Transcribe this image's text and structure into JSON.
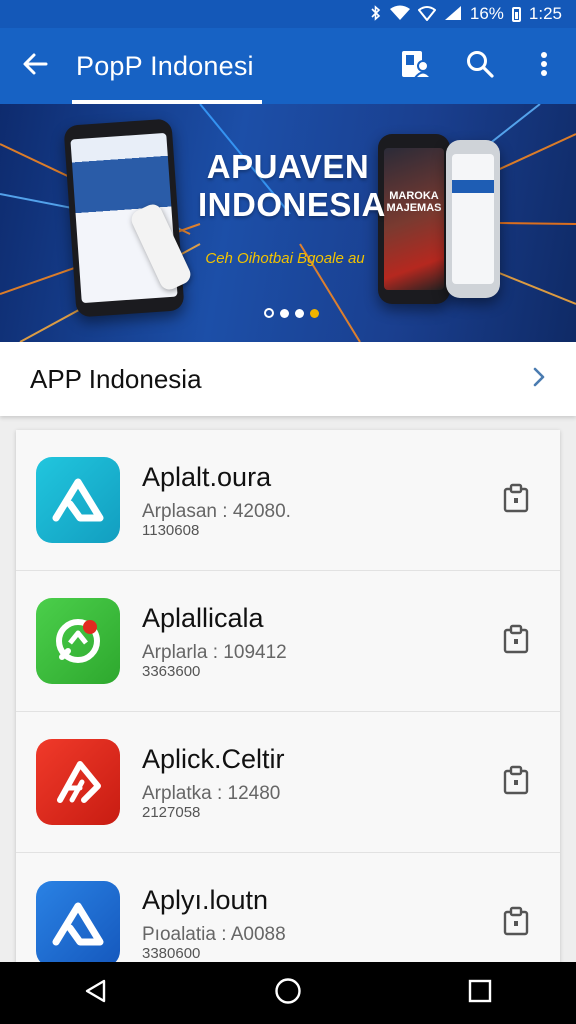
{
  "status_bar": {
    "battery_percent": "16%",
    "time": "1:25"
  },
  "app_bar": {
    "title": "PopP Indonesi"
  },
  "banner": {
    "title": "APUAVEN INDONESIA",
    "subtitle": "Ceh Oihotbai Bgoale au",
    "phone_caption": "MAROKA MAJEMAS",
    "slides": [
      {
        "style": "ring"
      },
      {
        "style": "plain"
      },
      {
        "style": "plain"
      },
      {
        "style": "active"
      }
    ]
  },
  "section": {
    "title": "APP Indonesia"
  },
  "apps": [
    {
      "name": "Aplalt.oura",
      "meta": "Arplasan : 42080.",
      "meta2": "1130608",
      "color": "#1cb7d3",
      "icon": "teal-arrow-icon"
    },
    {
      "name": "Aplallicala",
      "meta": "Arplarla : 109412",
      "meta2": "3363600",
      "color": "#3dbb3d",
      "icon": "green-chat-icon"
    },
    {
      "name": "Aplick.Celtir",
      "meta": "Arplatka : 12480",
      "meta2": "2127058",
      "color": "#e6281e",
      "icon": "red-arrow-icon"
    },
    {
      "name": "Aplyı.loutn",
      "meta": "Pıoalatia : A0088",
      "meta2": "3380600",
      "color": "#1f6fd1",
      "icon": "blue-arrow-icon"
    }
  ],
  "colors": {
    "app_bar": "#1762c4",
    "accent_dot": "#f0b400"
  }
}
